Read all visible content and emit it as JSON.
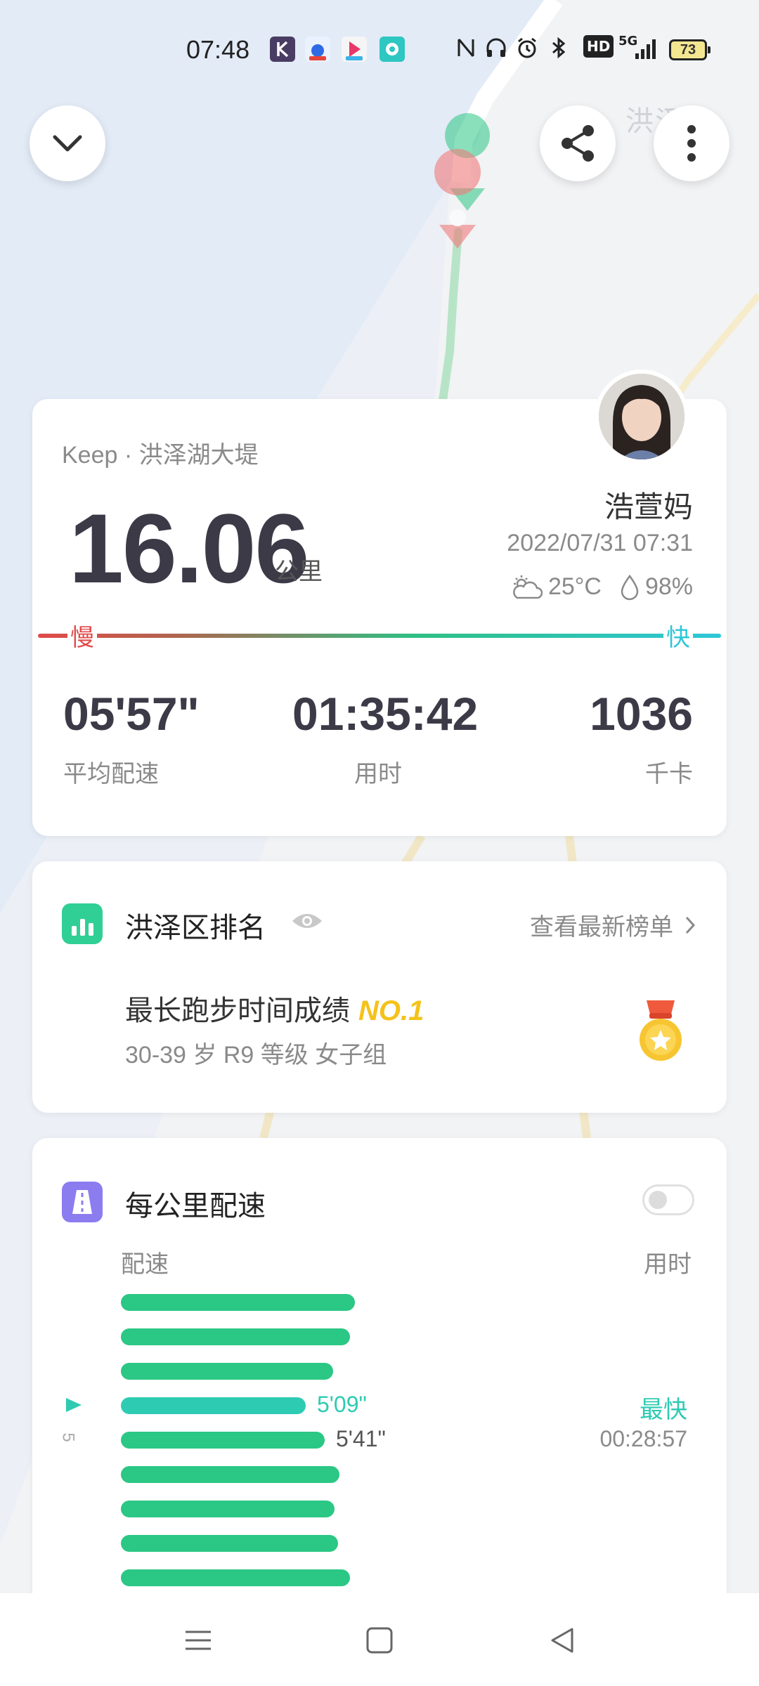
{
  "status_bar": {
    "time": "07:48",
    "network": "5G",
    "battery": "73",
    "hd": "HD"
  },
  "map": {
    "place_label": "洪泽"
  },
  "summary": {
    "source_location": "Keep · 洪泽湖大堤",
    "distance": "16.06",
    "distance_unit": "公里",
    "user_name": "浩萱妈",
    "datetime": "2022/07/31 07:31",
    "temperature": "25°C",
    "humidity": "98%",
    "slow_label": "慢",
    "fast_label": "快",
    "stats": [
      {
        "value": "05'57\"",
        "label": "平均配速"
      },
      {
        "value": "01:35:42",
        "label": "用时"
      },
      {
        "value": "1036",
        "label": "千卡"
      }
    ]
  },
  "ranking": {
    "title": "洪泽区排名",
    "view_link": "查看最新榜单",
    "achievement": "最长跑步时间成绩",
    "rank": "NO.1",
    "group": "30-39 岁 R9 等级 女子组"
  },
  "pace": {
    "title": "每公里配速",
    "col_pace": "配速",
    "col_time": "用时",
    "fastest_tag": "最快",
    "km_mark": "5",
    "splits": [
      {
        "km": 1,
        "pace_seconds": 392,
        "label": ""
      },
      {
        "km": 2,
        "pace_seconds": 383,
        "label": ""
      },
      {
        "km": 3,
        "pace_seconds": 355,
        "label": ""
      },
      {
        "km": 4,
        "pace_seconds": 309,
        "label": "5'09\"",
        "fastest": true
      },
      {
        "km": 5,
        "pace_seconds": 341,
        "label": "5'41\"",
        "time": "00:28:57"
      },
      {
        "km": 6,
        "pace_seconds": 366,
        "label": ""
      },
      {
        "km": 7,
        "pace_seconds": 358,
        "label": ""
      },
      {
        "km": 8,
        "pace_seconds": 364,
        "label": ""
      },
      {
        "km": 9,
        "pace_seconds": 383,
        "label": ""
      }
    ]
  },
  "colors": {
    "accent_green": "#2bc784",
    "fastest_teal": "#2ecbb3",
    "slow_red": "#e14a4a",
    "rank_gold": "#f5c21a",
    "pace_icon_purple": "#8b7cf0"
  }
}
